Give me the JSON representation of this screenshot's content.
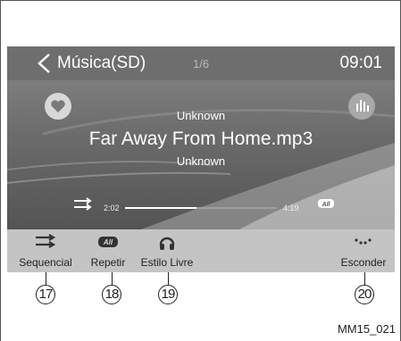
{
  "topbar": {
    "title": "Música(SD)",
    "track_position": "1/6",
    "clock": "09:01"
  },
  "track": {
    "artist": "Unknown",
    "song": "Far Away From Home.mp3",
    "album": "Unknown"
  },
  "progress": {
    "elapsed": "2:02",
    "total": "4:19",
    "fraction": 0.47
  },
  "repeat_badge": "All",
  "bottom_buttons": [
    {
      "label": "Sequencial",
      "icon": "shuffle-icon"
    },
    {
      "label": "Repetir",
      "icon": "repeat-all-icon"
    },
    {
      "label": "Estilo Livre",
      "icon": "headphones-icon"
    },
    {
      "label": "Esconder",
      "icon": "hide-dots-icon"
    }
  ],
  "callouts": [
    "17",
    "18",
    "19",
    "20"
  ],
  "figure_code": "MM15_021",
  "icons": {
    "back": "chevron-left-icon",
    "favorite": "heart-icon",
    "equalizer": "equalizer-icon"
  },
  "colors": {
    "screen_bg": "#8a8a8a",
    "topbar_bg": "#6e6e6e",
    "bottom_bar_bg": "#c4c4c4"
  }
}
